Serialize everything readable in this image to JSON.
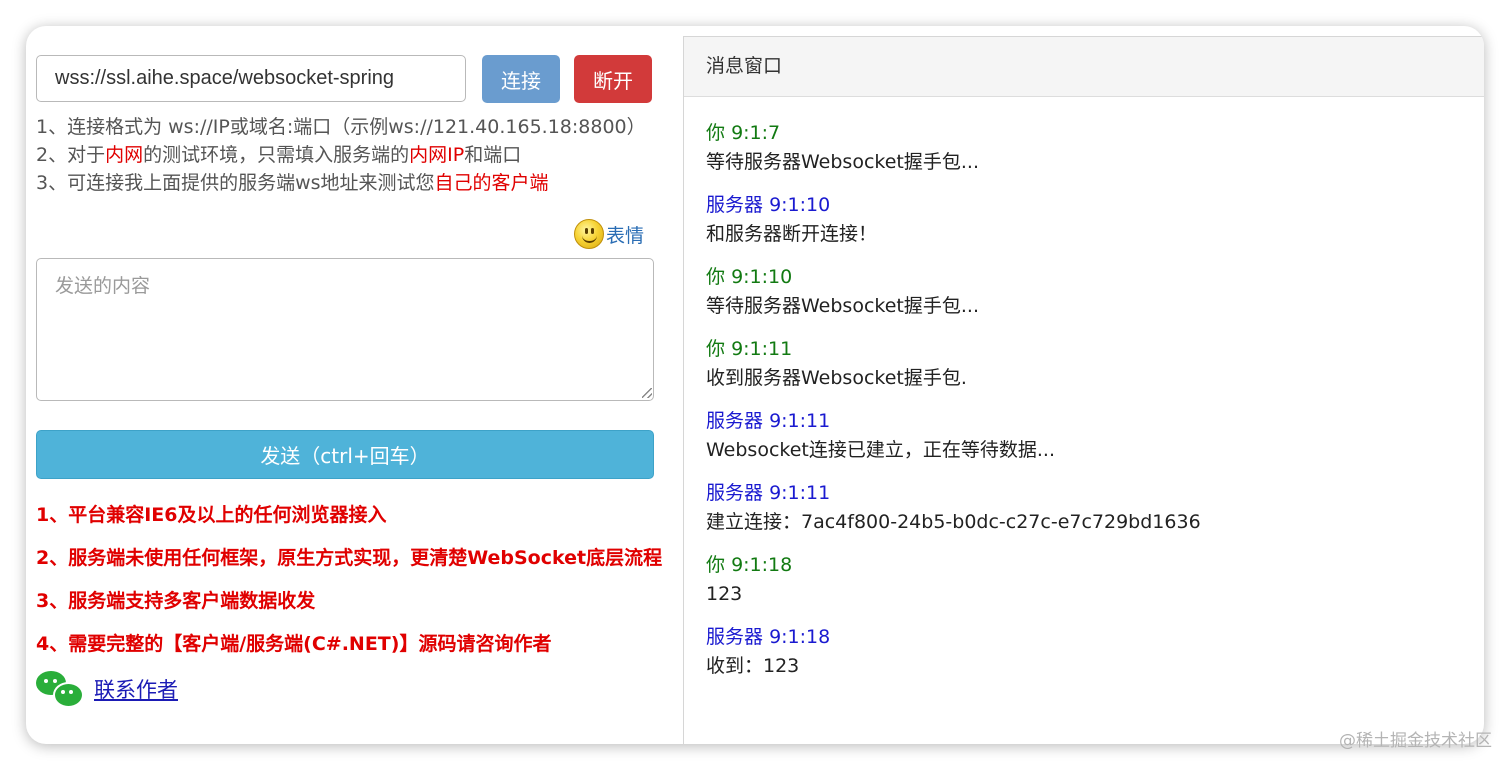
{
  "connection": {
    "url_value": "wss://ssl.aihe.space/websocket-spring",
    "connect_label": "连接",
    "disconnect_label": "断开"
  },
  "tips": [
    [
      {
        "text": "1、连接格式为 ws://IP或域名:端口（示例ws://121.40.165.18:8800）",
        "red": false
      }
    ],
    [
      {
        "text": "2、对于",
        "red": false
      },
      {
        "text": "内网",
        "red": true
      },
      {
        "text": "的测试环境，只需填入服务端的",
        "red": false
      },
      {
        "text": "内网IP",
        "red": true
      },
      {
        "text": "和端口",
        "red": false
      }
    ],
    [
      {
        "text": "3、可连接我上面提供的服务端ws地址来测试您",
        "red": false
      },
      {
        "text": "自己的客户端",
        "red": true
      }
    ]
  ],
  "emoji": {
    "icon": "smiley-face-icon",
    "label": "表情"
  },
  "composer": {
    "placeholder": "发送的内容",
    "send_label": "发送（ctrl+回车）"
  },
  "notes": [
    "1、平台兼容IE6及以上的任何浏览器接入",
    "2、服务端未使用任何框架，原生方式实现，更清楚WebSocket底层流程",
    "3、服务端支持多客户端数据收发",
    "4、需要完整的【客户端/服务端(C#.NET)】源码请咨询作者"
  ],
  "contact": {
    "icon": "wechat-icon",
    "label": "联系作者"
  },
  "message_panel": {
    "title": "消息窗口",
    "messages": [
      {
        "sender": "你",
        "time": "9:1:7",
        "role": "you",
        "text": "等待服务器Websocket握手包..."
      },
      {
        "sender": "服务器",
        "time": "9:1:10",
        "role": "server",
        "text": "和服务器断开连接！"
      },
      {
        "sender": "你",
        "time": "9:1:10",
        "role": "you",
        "text": "等待服务器Websocket握手包..."
      },
      {
        "sender": "你",
        "time": "9:1:11",
        "role": "you",
        "text": "收到服务器Websocket握手包."
      },
      {
        "sender": "服务器",
        "time": "9:1:11",
        "role": "server",
        "text": "Websocket连接已建立，正在等待数据..."
      },
      {
        "sender": "服务器",
        "time": "9:1:11",
        "role": "server",
        "text": "建立连接：7ac4f800-24b5-b0dc-c27c-e7c729bd1636"
      },
      {
        "sender": "你",
        "time": "9:1:18",
        "role": "you",
        "text": "123"
      },
      {
        "sender": "服务器",
        "time": "9:1:18",
        "role": "server",
        "text": "收到：123"
      }
    ]
  },
  "colors": {
    "you": "#127a12",
    "server": "#1a1ad0",
    "highlight_red": "#e00000"
  },
  "watermark": "@稀土掘金技术社区"
}
